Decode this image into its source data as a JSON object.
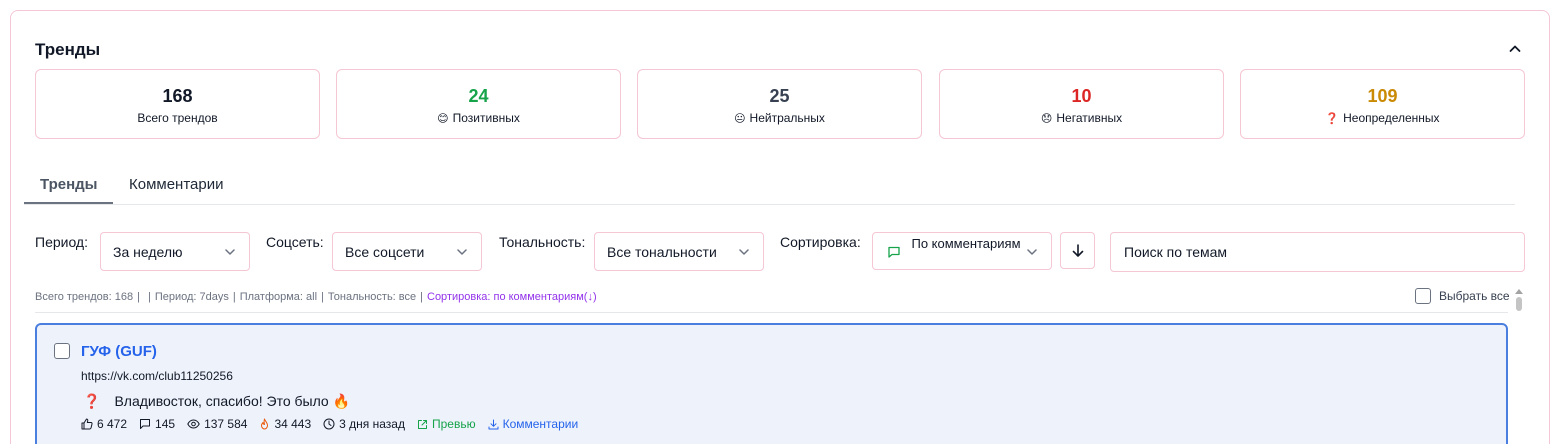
{
  "panel": {
    "title": "Тренды"
  },
  "stats": [
    {
      "value": "168",
      "label": "Всего трендов",
      "emoji": "",
      "color": "#111827"
    },
    {
      "value": "24",
      "label": "Позитивных",
      "emoji": "😊",
      "color": "#16a34a"
    },
    {
      "value": "25",
      "label": "Нейтральных",
      "emoji": "😐",
      "color": "#374151"
    },
    {
      "value": "10",
      "label": "Негативных",
      "emoji": "😞",
      "color": "#dc2626"
    },
    {
      "value": "109",
      "label": "Неопределенных",
      "emoji": "❓",
      "color": "#ca8a04"
    }
  ],
  "tabs": [
    {
      "label": "Тренды",
      "active": true
    },
    {
      "label": "Комментарии",
      "active": false
    }
  ],
  "filters": {
    "period_label": "Период:",
    "period_value": "За неделю",
    "network_label": "Соцсеть:",
    "network_value": "Все соцсети",
    "tone_label": "Тональность:",
    "tone_value": "Все тональности",
    "sort_label": "Сортировка:",
    "sort_value": "По комментариям",
    "search_placeholder": "Поиск по темам"
  },
  "summary": {
    "total": "Всего трендов: 168",
    "period": "Период: 7days",
    "platform": "Платформа: all",
    "tone": "Тональность: все",
    "sort": "Сортировка: по комментариям(↓)"
  },
  "select_all_label": "Выбрать все",
  "cards": [
    {
      "title": "ГУФ (GUF)",
      "url": "https://vk.com/club11250256",
      "status_icon": "❓",
      "text": "Владивосток, спасибо! Это было 🔥",
      "likes": "6 472",
      "comments": "145",
      "views": "137 584",
      "score": "34 443",
      "time": "3 дня назад",
      "preview_label": "Превью",
      "comments_label": "Комментарии"
    }
  ],
  "colors": {
    "border_pink": "#f5c6d3",
    "accent_blue": "#2563eb",
    "card_bg": "#eef2fb",
    "sort_info": "#9333ea"
  }
}
